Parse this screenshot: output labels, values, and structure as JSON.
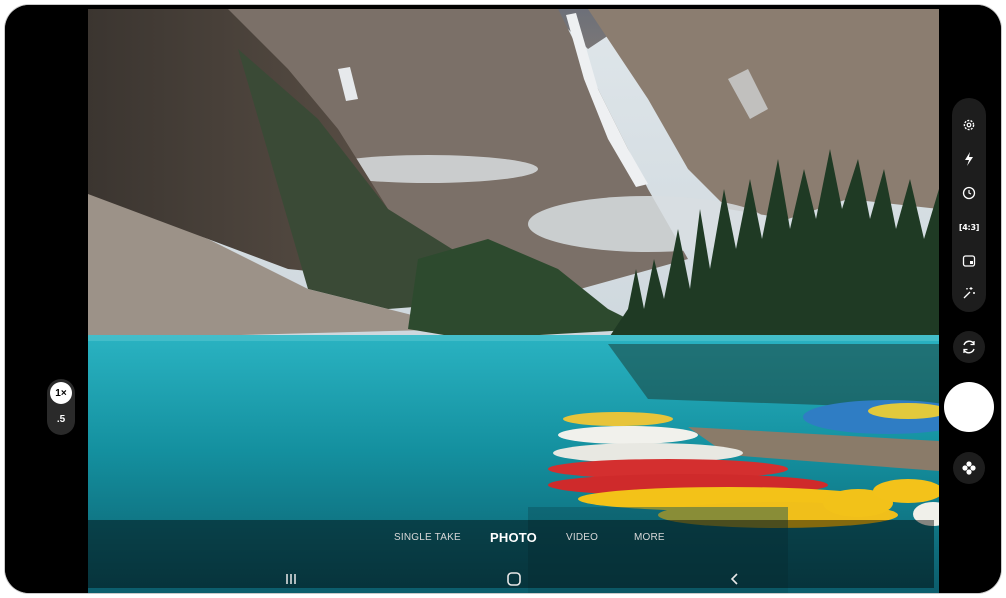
{
  "zoom": {
    "active": "1×",
    "wide": ".5"
  },
  "side_controls": {
    "settings_icon": "gear-icon",
    "flash_icon": "flash-icon",
    "timer_icon": "timer-icon",
    "aspect_ratio": "4:3",
    "motion_photo_icon": "motion-photo-icon",
    "filters_icon": "sparkle-icon",
    "switch_camera_icon": "switch-camera-icon",
    "effects_icon": "flower-icon"
  },
  "modes": [
    {
      "label": "SINGLE TAKE",
      "active": false
    },
    {
      "label": "PHOTO",
      "active": true
    },
    {
      "label": "VIDEO",
      "active": false
    },
    {
      "label": "MORE",
      "active": false
    }
  ],
  "nav": {
    "recents_icon": "recents-icon",
    "home_icon": "home-icon",
    "back_icon": "back-icon"
  },
  "colors": {
    "lake": "#1aa5b5",
    "shutter": "#ffffff",
    "active_mode": "#ffffff"
  }
}
